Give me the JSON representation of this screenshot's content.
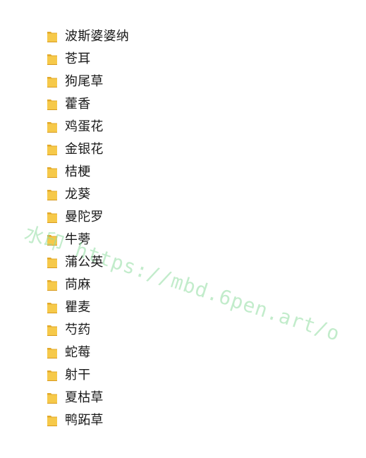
{
  "folder_list": {
    "items": [
      {
        "name": "波斯婆婆纳"
      },
      {
        "name": "苍耳"
      },
      {
        "name": "狗尾草"
      },
      {
        "name": "藿香"
      },
      {
        "name": "鸡蛋花"
      },
      {
        "name": "金银花"
      },
      {
        "name": "桔梗"
      },
      {
        "name": "龙葵"
      },
      {
        "name": "曼陀罗"
      },
      {
        "name": "牛蒡"
      },
      {
        "name": "蒲公英"
      },
      {
        "name": "苘麻"
      },
      {
        "name": "瞿麦"
      },
      {
        "name": "芍药"
      },
      {
        "name": "蛇莓"
      },
      {
        "name": "射干"
      },
      {
        "name": "夏枯草"
      },
      {
        "name": "鸭跖草"
      }
    ]
  },
  "watermark": {
    "text": "水印 https://mbd.6pen.art/o"
  },
  "colors": {
    "folder_yellow": "#f6c94a",
    "folder_dark": "#e2a92a",
    "text": "#1a1a1a",
    "watermark": "#90dca0"
  },
  "icons": {
    "folder": "folder-icon"
  }
}
